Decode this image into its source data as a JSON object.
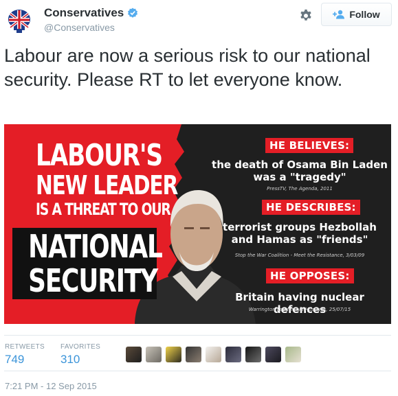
{
  "header": {
    "display_name": "Conservatives",
    "handle": "@Conservatives",
    "verified": true,
    "follow_label": "Follow",
    "avatar_icon": "union-jack-tree-logo",
    "settings_icon": "gear-icon"
  },
  "tweet": {
    "text": "Labour are now a serious risk to our national security. Please RT to let everyone know."
  },
  "image": {
    "headline_lines": [
      "LABOUR'S",
      "NEW LEADER",
      "IS A THREAT TO OUR",
      "NATIONAL",
      "SECURITY"
    ],
    "items": [
      {
        "label": "HE BELIEVES:",
        "claim_lines": [
          "the death of Osama Bin Laden",
          "was a \"tragedy\""
        ],
        "source": "PressTV, The Agenda, 2011"
      },
      {
        "label": "HE DESCRIBES:",
        "claim_lines": [
          "terrorist groups Hezbollah",
          "and Hamas as \"friends\""
        ],
        "source": "Stop the War Coalition - Meet the Resistance, 3/03/09"
      },
      {
        "label": "HE OPPOSES:",
        "claim_lines": [
          "Britain having nuclear defences"
        ],
        "source": "Warrington Leadership Hustings, 25/07/15"
      }
    ],
    "colors": {
      "red": "#e41e26",
      "dark": "#1f1f1f"
    }
  },
  "stats": {
    "retweets_label": "RETWEETS",
    "retweets_value": "749",
    "favorites_label": "FAVORITES",
    "favorites_value": "310"
  },
  "timestamp": "7:21 PM - 12 Sep 2015",
  "colors": {
    "link": "#3b94d9",
    "muted": "#8899a6",
    "verified": "#55acee"
  }
}
